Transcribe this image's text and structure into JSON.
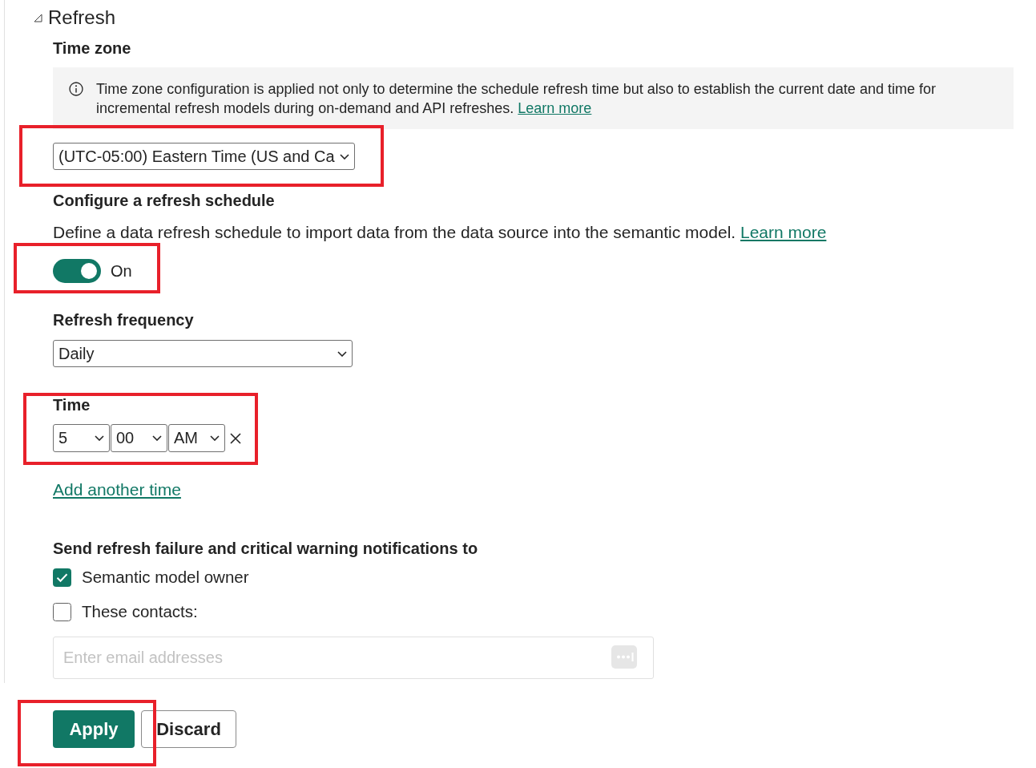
{
  "section": {
    "title": "Refresh",
    "expanded": true
  },
  "time_zone": {
    "label": "Time zone",
    "info": "Time zone configuration is applied not only to determine the schedule refresh time but also to establish the current date and time for incremental refresh models during on-demand and API refreshes.",
    "info_link": "Learn more",
    "value": "(UTC-05:00) Eastern Time (US and Ca",
    "highlighted": true
  },
  "schedule": {
    "title": "Configure a refresh schedule",
    "description": "Define a data refresh schedule to import data from the data source into the semantic model.",
    "link": "Learn more",
    "toggle": {
      "label": "On",
      "on": true,
      "highlighted": true
    }
  },
  "frequency": {
    "label": "Refresh frequency",
    "value": "Daily"
  },
  "time": {
    "label": "Time",
    "highlighted": true,
    "slots": [
      {
        "hour": "5",
        "minute": "00",
        "period": "AM"
      }
    ],
    "add_link": "Add another time"
  },
  "notifications": {
    "title": "Send refresh failure and critical warning notifications to",
    "options": [
      {
        "label": "Semantic model owner",
        "checked": true
      },
      {
        "label": "These contacts:",
        "checked": false
      }
    ],
    "email": {
      "placeholder": "Enter email addresses"
    }
  },
  "buttons": [
    {
      "label": "Apply",
      "kind": "primary",
      "highlighted": true
    },
    {
      "label": "Discard",
      "kind": "secondary",
      "highlighted": false
    }
  ]
}
